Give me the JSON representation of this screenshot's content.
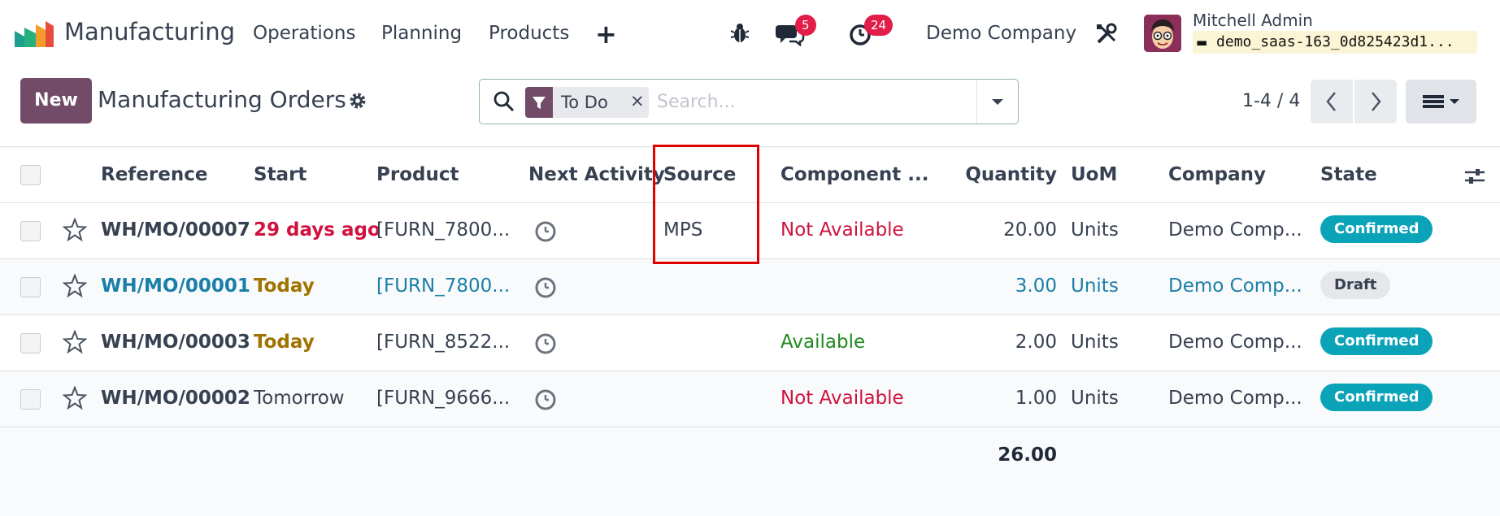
{
  "navbar": {
    "app_name": "Manufacturing",
    "menu": [
      "Operations",
      "Planning",
      "Products"
    ],
    "add_icon": "plus-icon",
    "bug_icon": "bug-icon",
    "messages_badge": "5",
    "activities_badge": "24",
    "company": "Demo Company",
    "settings_icon": "tools-icon",
    "user_name": "Mitchell Admin",
    "database": "demo_saas-163_0d825423d1..."
  },
  "control": {
    "new_label": "New",
    "title": "Manufacturing Orders",
    "facet_label": "To Do",
    "facet_remove": "×",
    "search_placeholder": "Search...",
    "pager": "1-4 / 4"
  },
  "table": {
    "headers": {
      "reference": "Reference",
      "start": "Start",
      "product": "Product",
      "next_activity": "Next Activity",
      "source": "Source",
      "component": "Component ...",
      "quantity": "Quantity",
      "uom": "UoM",
      "company": "Company",
      "state": "State"
    },
    "rows": [
      {
        "reference": "WH/MO/00007",
        "start": "29 days ago",
        "product": "[FURN_7800...",
        "source": "MPS",
        "component": "Not Available",
        "quantity": "20.00",
        "uom": "Units",
        "company": "Demo Comp...",
        "state": "Confirmed"
      },
      {
        "reference": "WH/MO/00001",
        "start": "Today",
        "product": "[FURN_7800...",
        "source": "",
        "component": "",
        "quantity": "3.00",
        "uom": "Units",
        "company": "Demo Comp...",
        "state": "Draft"
      },
      {
        "reference": "WH/MO/00003",
        "start": "Today",
        "product": "[FURN_8522...",
        "source": "",
        "component": "Available",
        "quantity": "2.00",
        "uom": "Units",
        "company": "Demo Comp...",
        "state": "Confirmed"
      },
      {
        "reference": "WH/MO/00002",
        "start": "Tomorrow",
        "product": "[FURN_9666...",
        "source": "",
        "component": "Not Available",
        "quantity": "1.00",
        "uom": "Units",
        "company": "Demo Comp...",
        "state": "Confirmed"
      }
    ],
    "total_quantity": "26.00"
  },
  "colors": {
    "brand": "#714b67",
    "danger": "#d0123f",
    "warning": "#a07200",
    "success": "#1f8a1f",
    "link": "#1a7fa8",
    "confirmed": "#0aa3b8"
  }
}
